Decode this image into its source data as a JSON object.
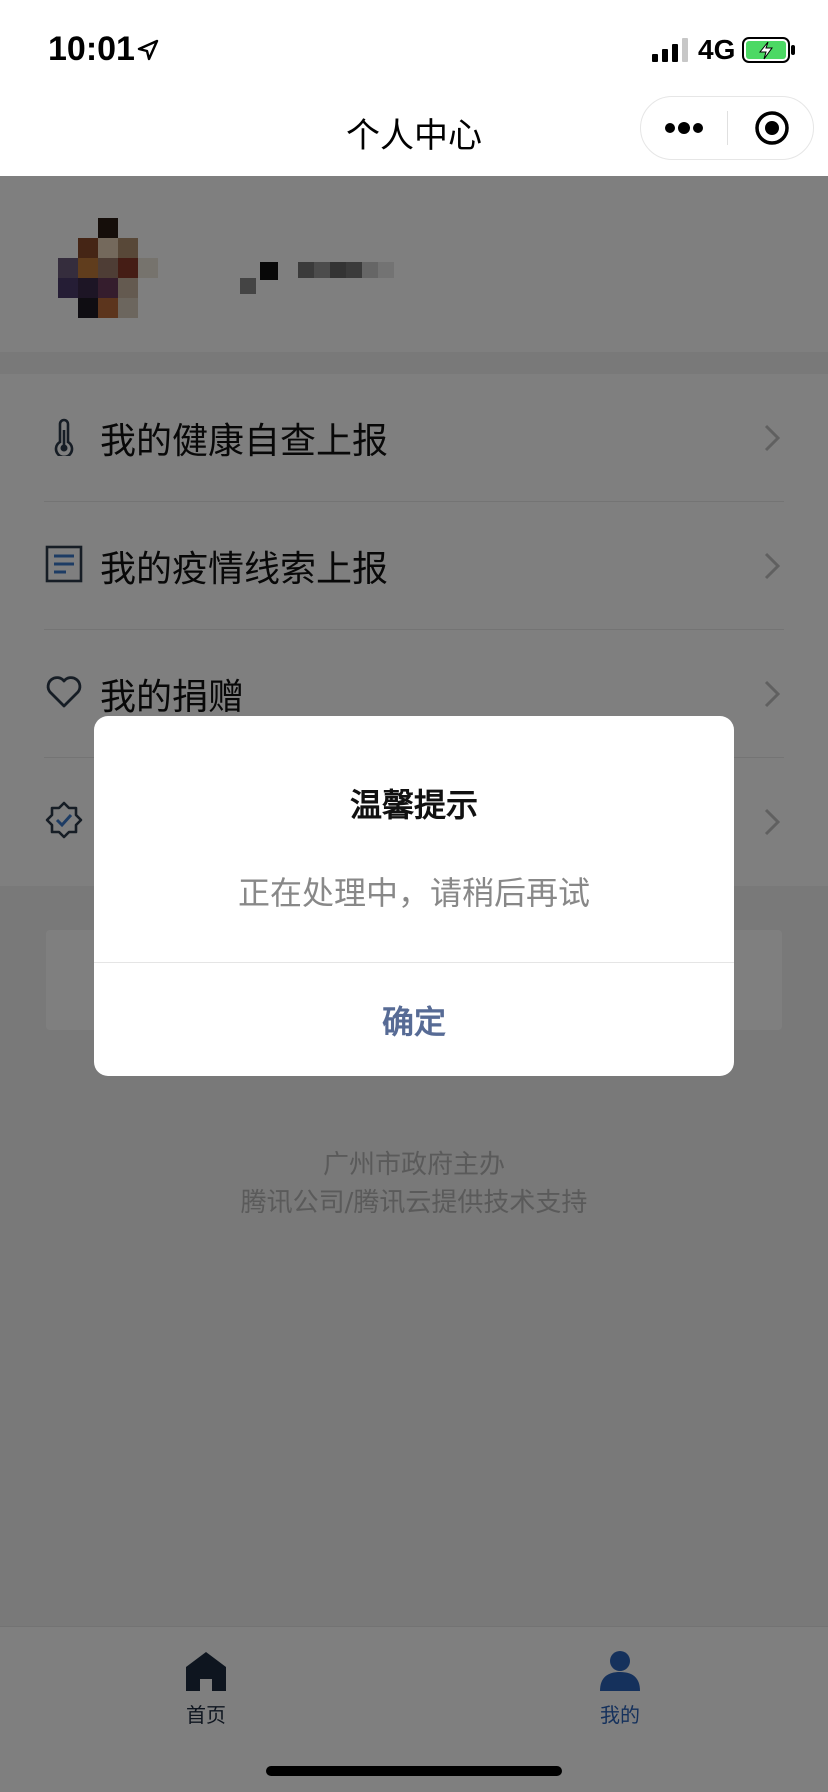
{
  "status_bar": {
    "time": "10:01",
    "network": "4G"
  },
  "nav": {
    "title": "个人中心"
  },
  "menu": {
    "items": [
      {
        "label": "我的健康自查上报",
        "icon": "thermometer-icon"
      },
      {
        "label": "我的疫情线索上报",
        "icon": "document-icon"
      },
      {
        "label": "我的捐赠",
        "icon": "heart-icon"
      },
      {
        "label": "",
        "icon": "verified-badge-icon"
      }
    ]
  },
  "footer": {
    "line1": "广州市政府主办",
    "line2": "腾讯公司/腾讯云提供技术支持"
  },
  "tab_bar": {
    "tabs": [
      {
        "label": "首页",
        "icon": "home-icon",
        "active": false
      },
      {
        "label": "我的",
        "icon": "person-icon",
        "active": true
      }
    ]
  },
  "dialog": {
    "title": "温馨提示",
    "message": "正在处理中，请稍后再试",
    "confirm_label": "确定"
  },
  "colors": {
    "accent": "#2b62b8",
    "dialog_button": "#576b95",
    "battery": "#4cd964"
  }
}
